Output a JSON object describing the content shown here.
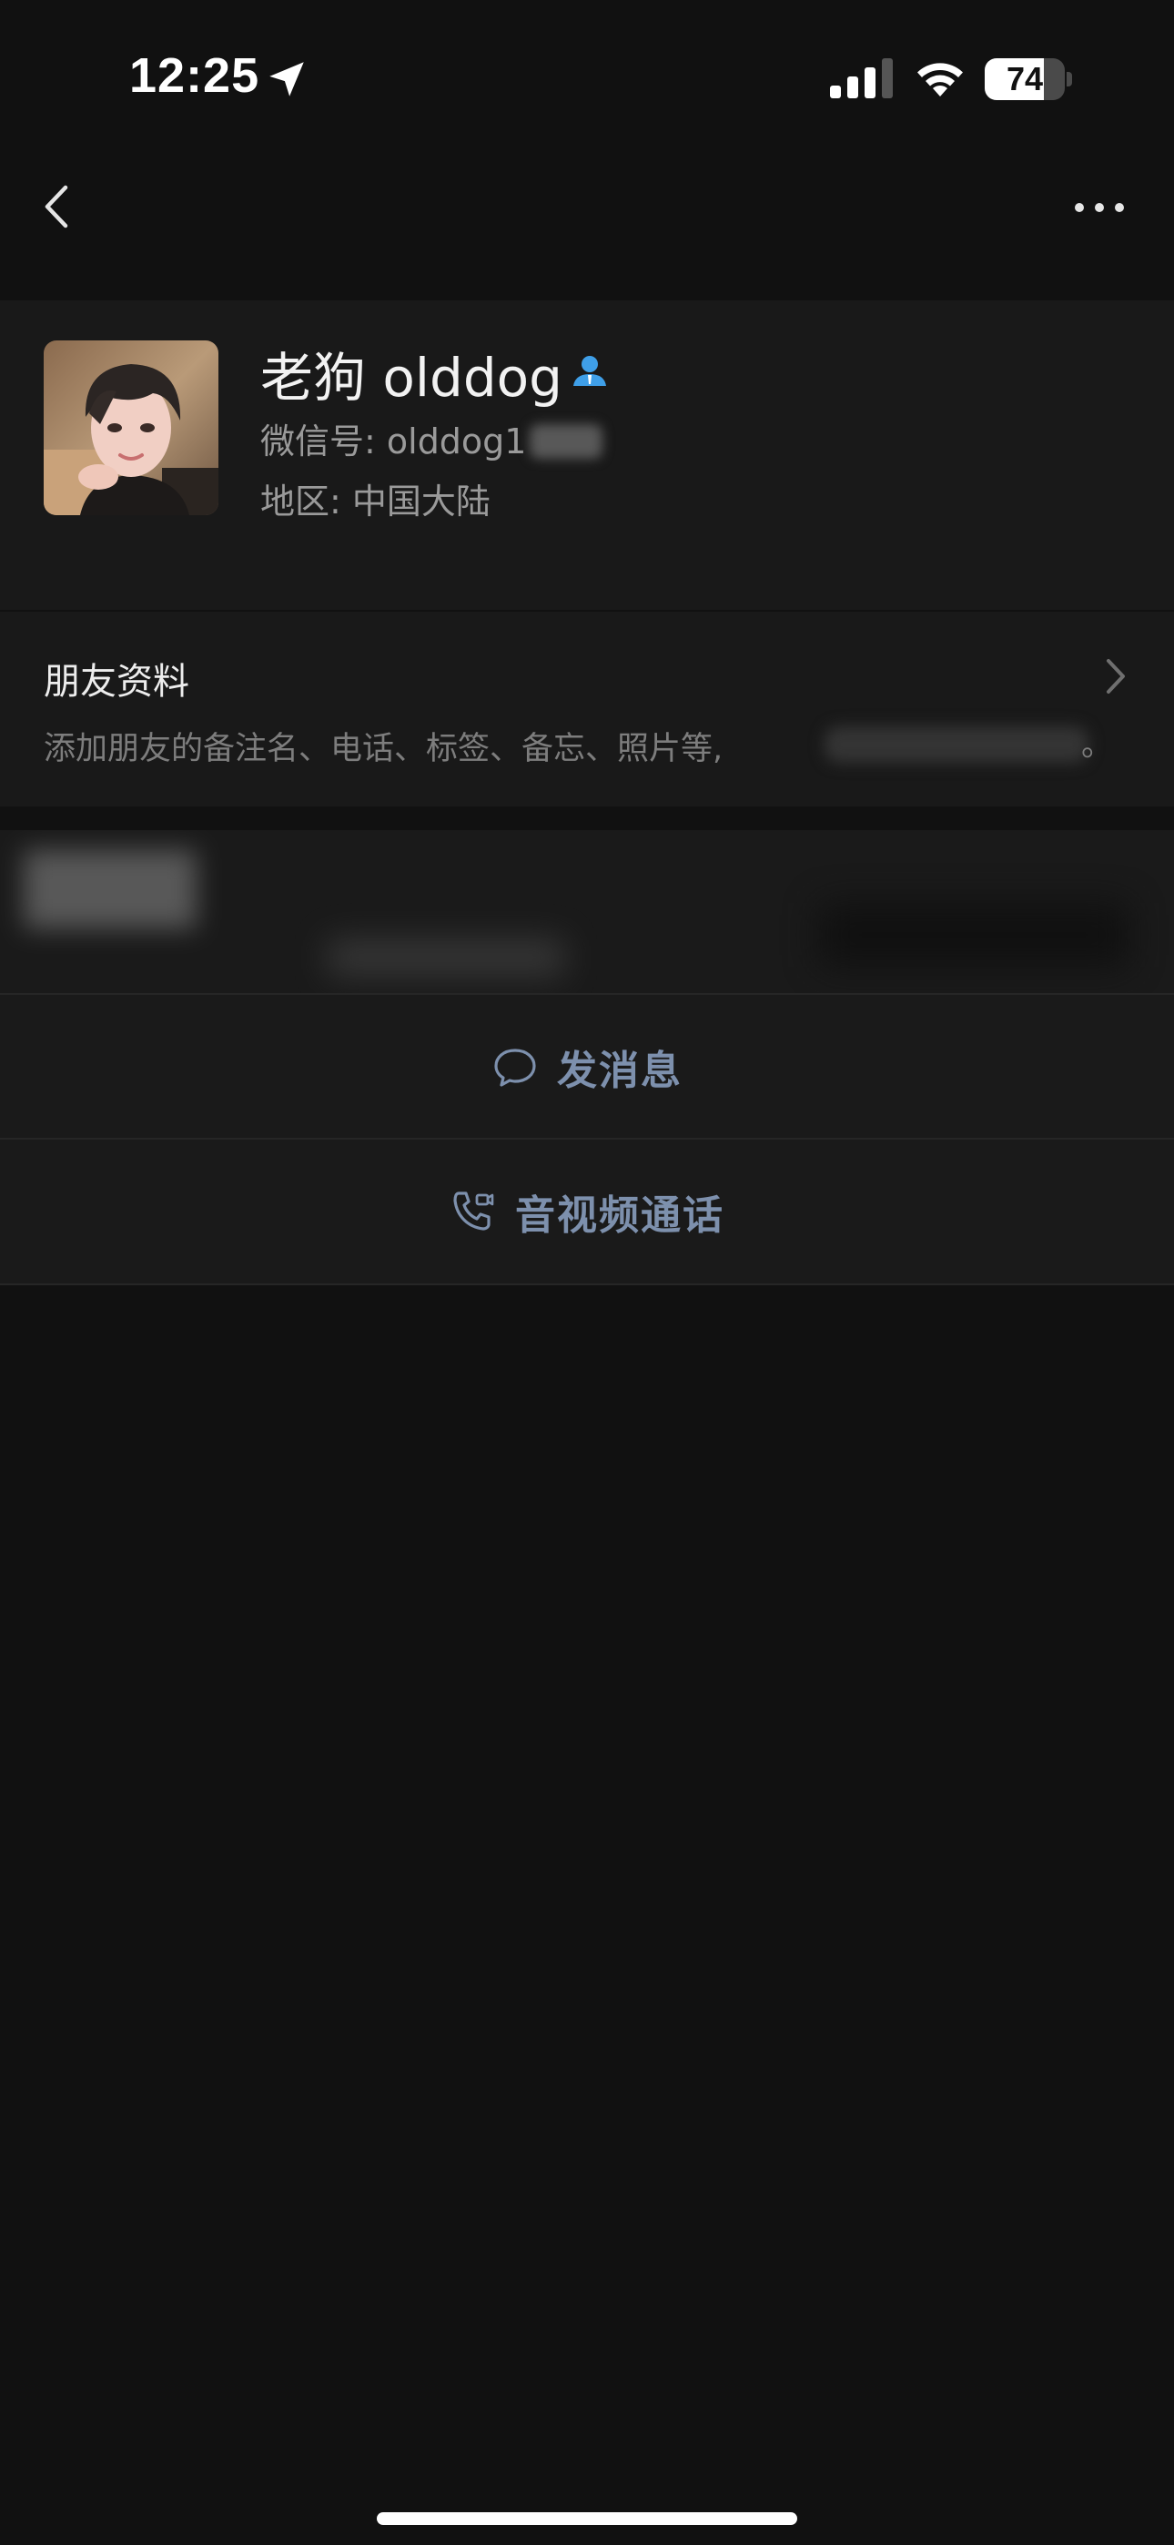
{
  "status_bar": {
    "time": "12:25",
    "battery_level": "74",
    "battery_fraction": 0.74,
    "icons": [
      "location-arrow-icon",
      "cellular-signal-icon",
      "wifi-icon",
      "battery-icon"
    ]
  },
  "nav": {
    "back_icon": "chevron-left-icon",
    "more_icon": "more-dots-icon"
  },
  "profile": {
    "name": "老狗 olddog",
    "wechat_id_text": "微信号: olddog1",
    "region_text": "地区: 中国大陆",
    "contact_badge_icon": "contact-person-icon"
  },
  "friend_info": {
    "title": "朋友资料",
    "description": "添加朋友的备注名、电话、标签、备忘、照片等,",
    "description_end": "。",
    "arrow_icon": "chevron-right-icon"
  },
  "actions": {
    "send_message_label": "发消息",
    "send_message_icon": "chat-bubble-icon",
    "av_call_label": "音视频通话",
    "av_call_icon": "phone-video-icon"
  },
  "colors": {
    "background": "#111111",
    "card": "#191919",
    "action_text": "#7d90ad",
    "contact_badge": "#3f9fe8"
  }
}
